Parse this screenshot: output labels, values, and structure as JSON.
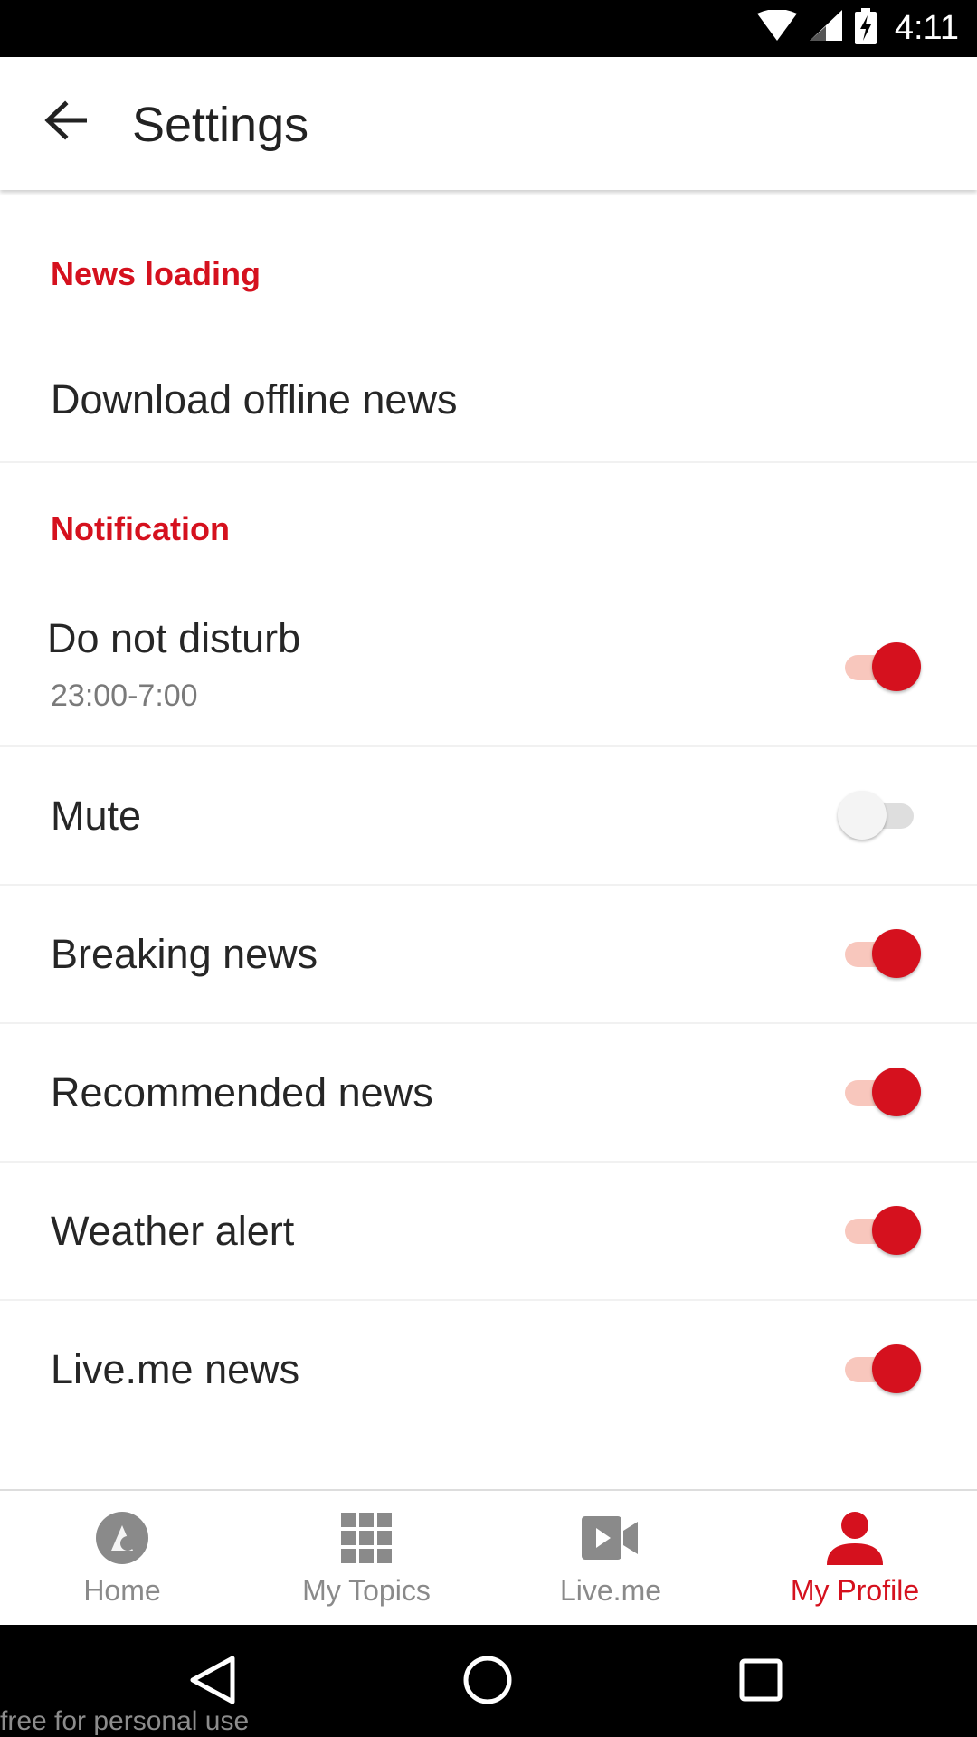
{
  "status_bar": {
    "time": "4:11",
    "icons": [
      "wifi-icon",
      "cell-signal-icon",
      "battery-charging-icon"
    ]
  },
  "toolbar": {
    "back_icon": "arrow-left-icon",
    "title": "Settings"
  },
  "sections": [
    {
      "header": "News loading",
      "rows": [
        {
          "title": "Download offline news"
        }
      ]
    },
    {
      "header": "Notification",
      "rows": [
        {
          "title": "Do not disturb",
          "subtitle": "23:00-7:00",
          "toggle": true
        },
        {
          "title": "Mute",
          "toggle": false
        },
        {
          "title": "Breaking news",
          "toggle": true
        },
        {
          "title": "Recommended news",
          "toggle": true
        },
        {
          "title": "Weather alert",
          "toggle": true
        },
        {
          "title": "Live.me news",
          "toggle": true
        }
      ]
    }
  ],
  "bottom_nav": {
    "items": [
      {
        "label": "Home",
        "icon": "home-icon",
        "active": false
      },
      {
        "label": "My Topics",
        "icon": "grid-icon",
        "active": false
      },
      {
        "label": "Live.me",
        "icon": "video-icon",
        "active": false
      },
      {
        "label": "My Profile",
        "icon": "person-icon",
        "active": true
      }
    ]
  },
  "system_nav": {
    "buttons": [
      "back-triangle-icon",
      "home-circle-icon",
      "recents-square-icon"
    ]
  },
  "watermark": "free for personal use",
  "colors": {
    "accent": "#d5111e",
    "toggle_track_on": "#f8c7bd",
    "toggle_off_track": "#dedede",
    "text_primary": "#262626",
    "text_secondary": "#7a7a7a",
    "nav_inactive": "#8a8a8a"
  }
}
